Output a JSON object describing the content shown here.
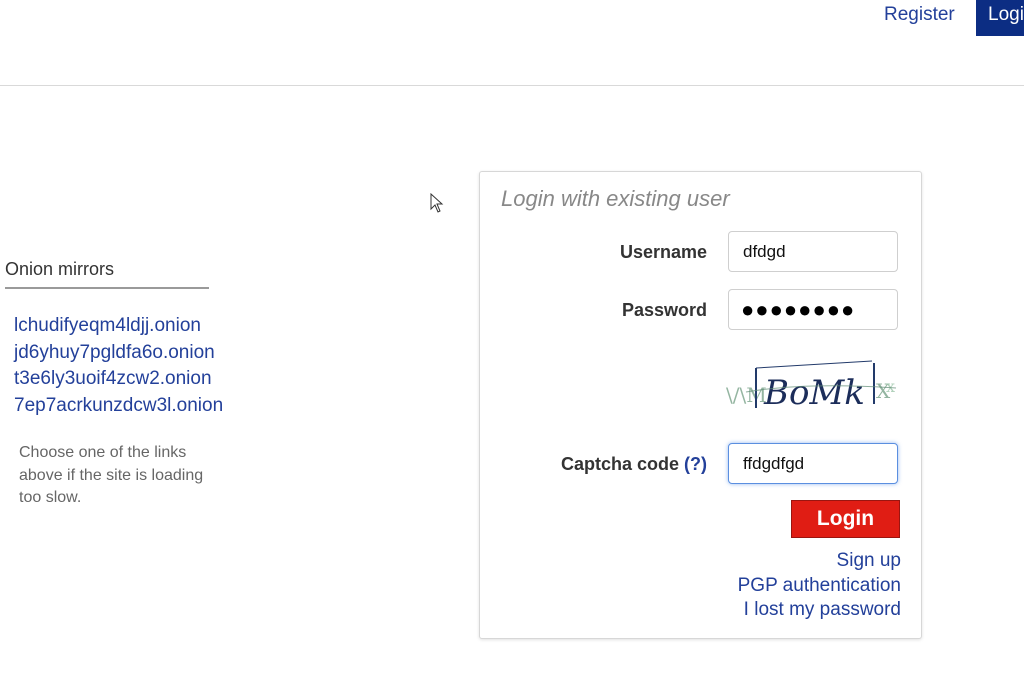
{
  "nav": {
    "register_label": "Register",
    "login_label": "Login"
  },
  "mirrors": {
    "title": "Onion mirrors",
    "links": [
      "lchudifyeqm4ldjj.onion",
      "jd6yhuy7pgldfa6o.onion",
      "t3e6ly3uoif4zcw2.onion",
      "7ep7acrkunzdcw3l.onion"
    ],
    "note": "Choose one of the links above if the site is loading too slow."
  },
  "login_form": {
    "title": "Login with existing user",
    "username_label": "Username",
    "username_value": "dfdgd",
    "password_label": "Password",
    "password_masked": "●●●●●●●●",
    "captcha_text": "BoMk",
    "captcha_label": "Captcha code",
    "captcha_help": "(?)",
    "captcha_value": "ffdgdfgd",
    "submit_label": "Login",
    "links": {
      "signup": "Sign up",
      "pgp": "PGP authentication",
      "lost_password": "I lost my password"
    }
  },
  "colors": {
    "link": "#23409a",
    "nav_active": "#0c2d83",
    "button": "#e01d14"
  }
}
